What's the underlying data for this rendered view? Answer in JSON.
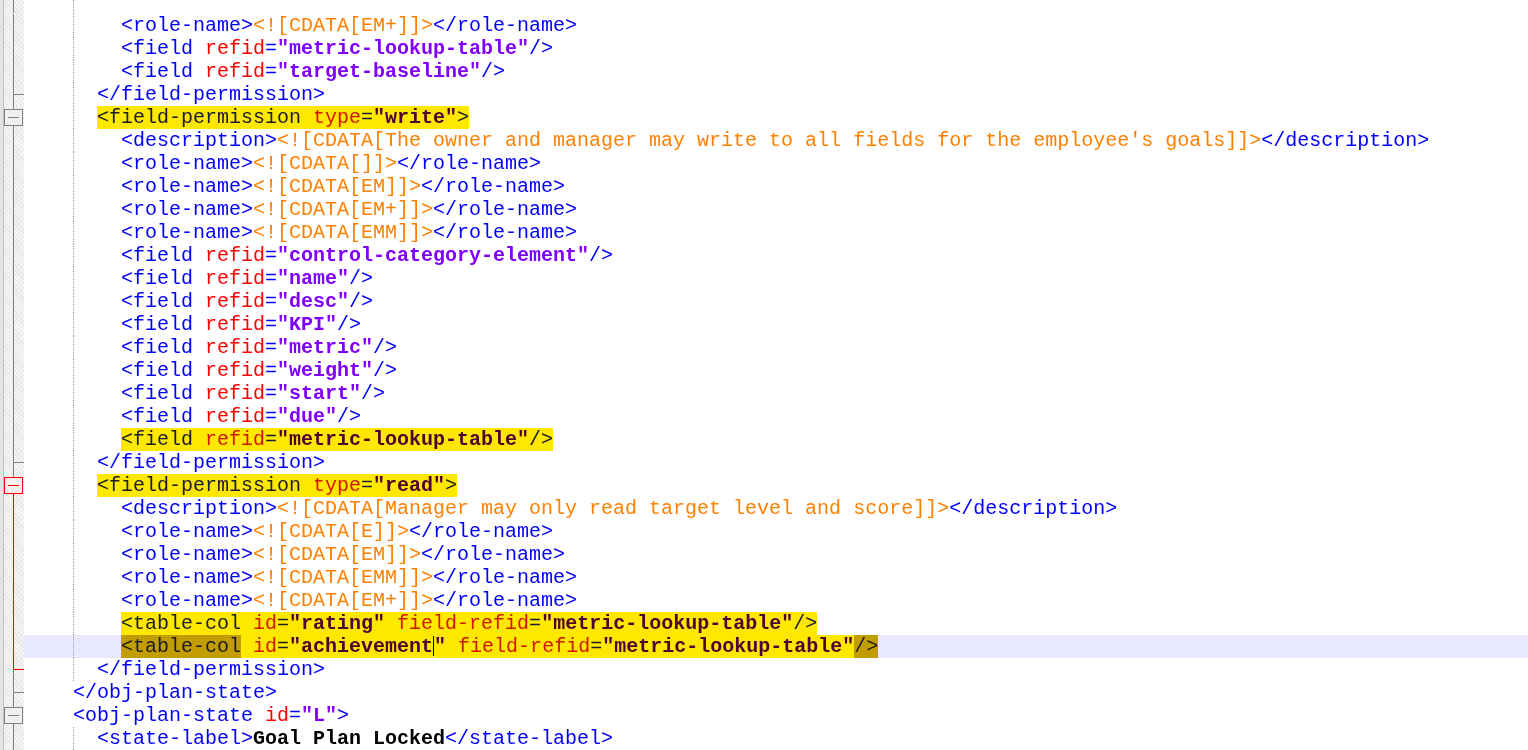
{
  "lines": [
    {
      "kind": "group",
      "children": [
        {
          "kind": "group",
          "children": [
            {
              "kind": "element",
              "current": false,
              "tokens": [
                {
                  "kind": "tag",
                  "text": "<role-name>",
                  "highlighted": false,
                  "match": false
                },
                {
                  "kind": "cdata",
                  "text": "<![CDATA[EM+]]>",
                  "highlighted": false,
                  "match": false
                },
                {
                  "kind": "tag",
                  "text": "</role-name>",
                  "highlighted": false,
                  "match": false
                }
              ]
            },
            {
              "kind": "element",
              "current": false,
              "tokens": [
                {
                  "kind": "tag",
                  "text": "<field",
                  "highlighted": false,
                  "match": false
                },
                {
                  "kind": "attr",
                  "text": " refid",
                  "highlighted": false,
                  "match": false
                },
                {
                  "kind": "tag",
                  "text": "=",
                  "highlighted": false,
                  "match": false
                },
                {
                  "kind": "value",
                  "text": "\"metric-lookup-table\"",
                  "highlighted": false,
                  "match": false
                },
                {
                  "kind": "tag",
                  "text": "/>",
                  "highlighted": false,
                  "match": false
                }
              ]
            },
            {
              "kind": "element",
              "current": false,
              "tokens": [
                {
                  "kind": "tag",
                  "text": "<field",
                  "highlighted": false,
                  "match": false
                },
                {
                  "kind": "attr",
                  "text": " refid",
                  "highlighted": false,
                  "match": false
                },
                {
                  "kind": "tag",
                  "text": "=",
                  "highlighted": false,
                  "match": false
                },
                {
                  "kind": "value",
                  "text": "\"target-baseline\"",
                  "highlighted": false,
                  "match": false
                },
                {
                  "kind": "tag",
                  "text": "/>",
                  "highlighted": false,
                  "match": false
                }
              ]
            }
          ]
        },
        {
          "kind": "close",
          "fold_active": false,
          "current": false,
          "tokens": [
            {
              "kind": "tag",
              "text": "</field-permission>",
              "highlighted": false,
              "match": false
            }
          ]
        },
        {
          "kind": "open",
          "fold_active": false,
          "current": false,
          "tokens": [
            {
              "kind": "tag",
              "text": "<field-permission",
              "highlighted": true,
              "match": false
            },
            {
              "kind": "attr",
              "text": " type",
              "highlighted": true,
              "match": false
            },
            {
              "kind": "tag",
              "text": "=",
              "highlighted": true,
              "match": false
            },
            {
              "kind": "value",
              "text": "\"write\"",
              "highlighted": true,
              "match": false
            },
            {
              "kind": "tag",
              "text": ">",
              "highlighted": true,
              "match": false
            }
          ],
          "children": [
            {
              "kind": "element",
              "current": false,
              "tokens": [
                {
                  "kind": "tag",
                  "text": "<description>",
                  "highlighted": false,
                  "match": false
                },
                {
                  "kind": "cdata",
                  "text": "<![CDATA[The owner and manager may write to all fields for the employee's goals]]>",
                  "highlighted": false,
                  "match": false
                },
                {
                  "kind": "tag",
                  "text": "</description>",
                  "highlighted": false,
                  "match": false
                }
              ]
            },
            {
              "kind": "element",
              "current": false,
              "tokens": [
                {
                  "kind": "tag",
                  "text": "<role-name>",
                  "highlighted": false,
                  "match": false
                },
                {
                  "kind": "cdata",
                  "text": "<![CDATA[]]>",
                  "highlighted": false,
                  "match": false
                },
                {
                  "kind": "tag",
                  "text": "</role-name>",
                  "highlighted": false,
                  "match": false
                }
              ]
            },
            {
              "kind": "element",
              "current": false,
              "tokens": [
                {
                  "kind": "tag",
                  "text": "<role-name>",
                  "highlighted": false,
                  "match": false
                },
                {
                  "kind": "cdata",
                  "text": "<![CDATA[EM]]>",
                  "highlighted": false,
                  "match": false
                },
                {
                  "kind": "tag",
                  "text": "</role-name>",
                  "highlighted": false,
                  "match": false
                }
              ]
            },
            {
              "kind": "element",
              "current": false,
              "tokens": [
                {
                  "kind": "tag",
                  "text": "<role-name>",
                  "highlighted": false,
                  "match": false
                },
                {
                  "kind": "cdata",
                  "text": "<![CDATA[EM+]]>",
                  "highlighted": false,
                  "match": false
                },
                {
                  "kind": "tag",
                  "text": "</role-name>",
                  "highlighted": false,
                  "match": false
                }
              ]
            },
            {
              "kind": "element",
              "current": false,
              "tokens": [
                {
                  "kind": "tag",
                  "text": "<role-name>",
                  "highlighted": false,
                  "match": false
                },
                {
                  "kind": "cdata",
                  "text": "<![CDATA[EMM]]>",
                  "highlighted": false,
                  "match": false
                },
                {
                  "kind": "tag",
                  "text": "</role-name>",
                  "highlighted": false,
                  "match": false
                }
              ]
            },
            {
              "kind": "element",
              "current": false,
              "tokens": [
                {
                  "kind": "tag",
                  "text": "<field",
                  "highlighted": false,
                  "match": false
                },
                {
                  "kind": "attr",
                  "text": " refid",
                  "highlighted": false,
                  "match": false
                },
                {
                  "kind": "tag",
                  "text": "=",
                  "highlighted": false,
                  "match": false
                },
                {
                  "kind": "value",
                  "text": "\"control-category-element\"",
                  "highlighted": false,
                  "match": false
                },
                {
                  "kind": "tag",
                  "text": "/>",
                  "highlighted": false,
                  "match": false
                }
              ]
            },
            {
              "kind": "element",
              "current": false,
              "tokens": [
                {
                  "kind": "tag",
                  "text": "<field",
                  "highlighted": false,
                  "match": false
                },
                {
                  "kind": "attr",
                  "text": " refid",
                  "highlighted": false,
                  "match": false
                },
                {
                  "kind": "tag",
                  "text": "=",
                  "highlighted": false,
                  "match": false
                },
                {
                  "kind": "value",
                  "text": "\"name\"",
                  "highlighted": false,
                  "match": false
                },
                {
                  "kind": "tag",
                  "text": "/>",
                  "highlighted": false,
                  "match": false
                }
              ]
            },
            {
              "kind": "element",
              "current": false,
              "tokens": [
                {
                  "kind": "tag",
                  "text": "<field",
                  "highlighted": false,
                  "match": false
                },
                {
                  "kind": "attr",
                  "text": " refid",
                  "highlighted": false,
                  "match": false
                },
                {
                  "kind": "tag",
                  "text": "=",
                  "highlighted": false,
                  "match": false
                },
                {
                  "kind": "value",
                  "text": "\"desc\"",
                  "highlighted": false,
                  "match": false
                },
                {
                  "kind": "tag",
                  "text": "/>",
                  "highlighted": false,
                  "match": false
                }
              ]
            },
            {
              "kind": "element",
              "current": false,
              "tokens": [
                {
                  "kind": "tag",
                  "text": "<field",
                  "highlighted": false,
                  "match": false
                },
                {
                  "kind": "attr",
                  "text": " refid",
                  "highlighted": false,
                  "match": false
                },
                {
                  "kind": "tag",
                  "text": "=",
                  "highlighted": false,
                  "match": false
                },
                {
                  "kind": "value",
                  "text": "\"KPI\"",
                  "highlighted": false,
                  "match": false
                },
                {
                  "kind": "tag",
                  "text": "/>",
                  "highlighted": false,
                  "match": false
                }
              ]
            },
            {
              "kind": "element",
              "current": false,
              "tokens": [
                {
                  "kind": "tag",
                  "text": "<field",
                  "highlighted": false,
                  "match": false
                },
                {
                  "kind": "attr",
                  "text": " refid",
                  "highlighted": false,
                  "match": false
                },
                {
                  "kind": "tag",
                  "text": "=",
                  "highlighted": false,
                  "match": false
                },
                {
                  "kind": "value",
                  "text": "\"metric\"",
                  "highlighted": false,
                  "match": false
                },
                {
                  "kind": "tag",
                  "text": "/>",
                  "highlighted": false,
                  "match": false
                }
              ]
            },
            {
              "kind": "element",
              "current": false,
              "tokens": [
                {
                  "kind": "tag",
                  "text": "<field",
                  "highlighted": false,
                  "match": false
                },
                {
                  "kind": "attr",
                  "text": " refid",
                  "highlighted": false,
                  "match": false
                },
                {
                  "kind": "tag",
                  "text": "=",
                  "highlighted": false,
                  "match": false
                },
                {
                  "kind": "value",
                  "text": "\"weight\"",
                  "highlighted": false,
                  "match": false
                },
                {
                  "kind": "tag",
                  "text": "/>",
                  "highlighted": false,
                  "match": false
                }
              ]
            },
            {
              "kind": "element",
              "current": false,
              "tokens": [
                {
                  "kind": "tag",
                  "text": "<field",
                  "highlighted": false,
                  "match": false
                },
                {
                  "kind": "attr",
                  "text": " refid",
                  "highlighted": false,
                  "match": false
                },
                {
                  "kind": "tag",
                  "text": "=",
                  "highlighted": false,
                  "match": false
                },
                {
                  "kind": "value",
                  "text": "\"start\"",
                  "highlighted": false,
                  "match": false
                },
                {
                  "kind": "tag",
                  "text": "/>",
                  "highlighted": false,
                  "match": false
                }
              ]
            },
            {
              "kind": "element",
              "current": false,
              "tokens": [
                {
                  "kind": "tag",
                  "text": "<field",
                  "highlighted": false,
                  "match": false
                },
                {
                  "kind": "attr",
                  "text": " refid",
                  "highlighted": false,
                  "match": false
                },
                {
                  "kind": "tag",
                  "text": "=",
                  "highlighted": false,
                  "match": false
                },
                {
                  "kind": "value",
                  "text": "\"due\"",
                  "highlighted": false,
                  "match": false
                },
                {
                  "kind": "tag",
                  "text": "/>",
                  "highlighted": false,
                  "match": false
                }
              ]
            },
            {
              "kind": "element",
              "current": false,
              "tokens": [
                {
                  "kind": "tag",
                  "text": "<field",
                  "highlighted": true,
                  "match": false
                },
                {
                  "kind": "attr",
                  "text": " refid",
                  "highlighted": true,
                  "match": false
                },
                {
                  "kind": "tag",
                  "text": "=",
                  "highlighted": true,
                  "match": false
                },
                {
                  "kind": "value",
                  "text": "\"metric-lookup-table\"",
                  "highlighted": true,
                  "match": false
                },
                {
                  "kind": "tag",
                  "text": "/>",
                  "highlighted": true,
                  "match": false
                }
              ]
            }
          ]
        },
        {
          "kind": "close",
          "fold_active": false,
          "current": false,
          "tokens": [
            {
              "kind": "tag",
              "text": "</field-permission>",
              "highlighted": false,
              "match": false
            }
          ]
        },
        {
          "kind": "open",
          "fold_active": true,
          "current": false,
          "tokens": [
            {
              "kind": "tag",
              "text": "<field-permission",
              "highlighted": true,
              "match": false
            },
            {
              "kind": "attr",
              "text": " type",
              "highlighted": true,
              "match": false
            },
            {
              "kind": "tag",
              "text": "=",
              "highlighted": true,
              "match": false
            },
            {
              "kind": "value",
              "text": "\"read\"",
              "highlighted": true,
              "match": false
            },
            {
              "kind": "tag",
              "text": ">",
              "highlighted": true,
              "match": false
            }
          ],
          "children": [
            {
              "kind": "element",
              "current": false,
              "tokens": [
                {
                  "kind": "tag",
                  "text": "<description>",
                  "highlighted": false,
                  "match": false
                },
                {
                  "kind": "cdata",
                  "text": "<![CDATA[Manager may only read target level and score]]>",
                  "highlighted": false,
                  "match": false
                },
                {
                  "kind": "tag",
                  "text": "</description>",
                  "highlighted": false,
                  "match": false
                }
              ]
            },
            {
              "kind": "element",
              "current": false,
              "tokens": [
                {
                  "kind": "tag",
                  "text": "<role-name>",
                  "highlighted": false,
                  "match": false
                },
                {
                  "kind": "cdata",
                  "text": "<![CDATA[E]]>",
                  "highlighted": false,
                  "match": false
                },
                {
                  "kind": "tag",
                  "text": "</role-name>",
                  "highlighted": false,
                  "match": false
                }
              ]
            },
            {
              "kind": "element",
              "current": false,
              "tokens": [
                {
                  "kind": "tag",
                  "text": "<role-name>",
                  "highlighted": false,
                  "match": false
                },
                {
                  "kind": "cdata",
                  "text": "<![CDATA[EM]]>",
                  "highlighted": false,
                  "match": false
                },
                {
                  "kind": "tag",
                  "text": "</role-name>",
                  "highlighted": false,
                  "match": false
                }
              ]
            },
            {
              "kind": "element",
              "current": false,
              "tokens": [
                {
                  "kind": "tag",
                  "text": "<role-name>",
                  "highlighted": false,
                  "match": false
                },
                {
                  "kind": "cdata",
                  "text": "<![CDATA[EMM]]>",
                  "highlighted": false,
                  "match": false
                },
                {
                  "kind": "tag",
                  "text": "</role-name>",
                  "highlighted": false,
                  "match": false
                }
              ]
            },
            {
              "kind": "element",
              "current": false,
              "tokens": [
                {
                  "kind": "tag",
                  "text": "<role-name>",
                  "highlighted": false,
                  "match": false
                },
                {
                  "kind": "cdata",
                  "text": "<![CDATA[EM+]]>",
                  "highlighted": false,
                  "match": false
                },
                {
                  "kind": "tag",
                  "text": "</role-name>",
                  "highlighted": false,
                  "match": false
                }
              ]
            },
            {
              "kind": "element",
              "current": false,
              "tokens": [
                {
                  "kind": "tag",
                  "text": "<table-col",
                  "highlighted": true,
                  "match": false
                },
                {
                  "kind": "attr",
                  "text": " id",
                  "highlighted": true,
                  "match": false
                },
                {
                  "kind": "tag",
                  "text": "=",
                  "highlighted": true,
                  "match": false
                },
                {
                  "kind": "value",
                  "text": "\"rating\"",
                  "highlighted": true,
                  "match": false
                },
                {
                  "kind": "attr",
                  "text": " field-refid",
                  "highlighted": true,
                  "match": false
                },
                {
                  "kind": "tag",
                  "text": "=",
                  "highlighted": true,
                  "match": false
                },
                {
                  "kind": "value",
                  "text": "\"metric-lookup-table\"",
                  "highlighted": true,
                  "match": false
                },
                {
                  "kind": "tag",
                  "text": "/>",
                  "highlighted": true,
                  "match": false
                }
              ]
            },
            {
              "kind": "element",
              "current": true,
              "tokens": [
                {
                  "kind": "tag",
                  "text": "<table-col",
                  "highlighted": true,
                  "match": true
                },
                {
                  "kind": "attr",
                  "text": " id",
                  "highlighted": true,
                  "match": false
                },
                {
                  "kind": "tag",
                  "text": "=",
                  "highlighted": true,
                  "match": false
                },
                {
                  "kind": "value",
                  "text": "\"achievement",
                  "highlighted": true,
                  "match": false
                },
                {
                  "kind": "caret"
                },
                {
                  "kind": "value",
                  "text": "\"",
                  "highlighted": true,
                  "match": false
                },
                {
                  "kind": "attr",
                  "text": " field-refid",
                  "highlighted": true,
                  "match": false
                },
                {
                  "kind": "tag",
                  "text": "=",
                  "highlighted": true,
                  "match": false
                },
                {
                  "kind": "value",
                  "text": "\"metric-lookup-table\"",
                  "highlighted": true,
                  "match": false
                },
                {
                  "kind": "tag",
                  "text": "/>",
                  "highlighted": true,
                  "match": true
                }
              ]
            }
          ]
        },
        {
          "kind": "close",
          "fold_active": true,
          "current": false,
          "tokens": [
            {
              "kind": "tag",
              "text": "</field-permission>",
              "highlighted": false,
              "match": false
            }
          ]
        }
      ]
    },
    {
      "kind": "close",
      "fold_active": false,
      "current": false,
      "tokens": [
        {
          "kind": "tag",
          "text": "</obj-plan-state>",
          "highlighted": false,
          "match": false
        }
      ]
    },
    {
      "kind": "open",
      "fold_active": false,
      "current": false,
      "tokens": [
        {
          "kind": "tag",
          "text": "<obj-plan-state",
          "highlighted": false,
          "match": false
        },
        {
          "kind": "attr",
          "text": " id",
          "highlighted": false,
          "match": false
        },
        {
          "kind": "tag",
          "text": "=",
          "highlighted": false,
          "match": false
        },
        {
          "kind": "value",
          "text": "\"L\"",
          "highlighted": false,
          "match": false
        },
        {
          "kind": "tag",
          "text": ">",
          "highlighted": false,
          "match": false
        }
      ],
      "children": [
        {
          "kind": "element",
          "current": false,
          "tokens": [
            {
              "kind": "tag",
              "text": "<state-label>",
              "highlighted": false,
              "match": false
            },
            {
              "kind": "text",
              "text": "Goal Plan Locked",
              "highlighted": false,
              "match": false
            },
            {
              "kind": "tag",
              "text": "</state-label>",
              "highlighted": false,
              "match": false
            }
          ]
        }
      ]
    }
  ]
}
